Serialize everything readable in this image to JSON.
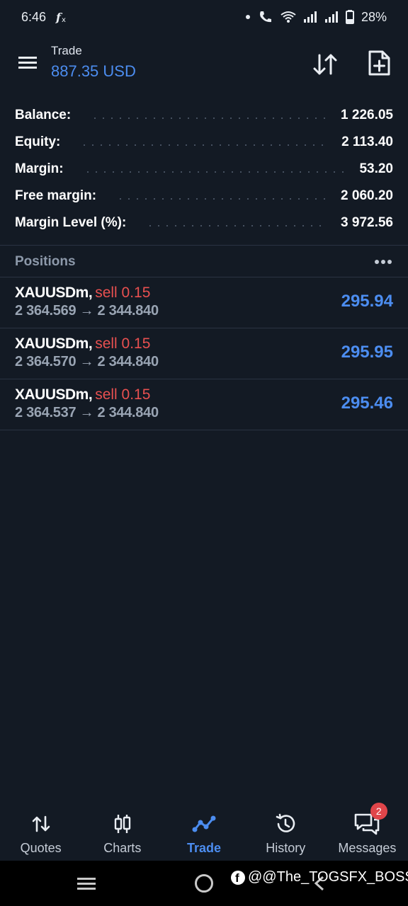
{
  "status_bar": {
    "time": "6:46",
    "battery": "28%"
  },
  "header": {
    "title": "Trade",
    "balance": "887.35 USD"
  },
  "summary": [
    {
      "label": "Balance:",
      "value": "1 226.05"
    },
    {
      "label": "Equity:",
      "value": "2 113.40"
    },
    {
      "label": "Margin:",
      "value": "53.20"
    },
    {
      "label": "Free margin:",
      "value": "2 060.20"
    },
    {
      "label": "Margin Level (%):",
      "value": "3 972.56"
    }
  ],
  "positions": {
    "title": "Positions",
    "items": [
      {
        "symbol": "XAUUSDm,",
        "side": "sell 0.15",
        "prices": "2 364.569 → 2 344.840",
        "profit": "295.94"
      },
      {
        "symbol": "XAUUSDm,",
        "side": "sell 0.15",
        "prices": "2 364.570 → 2 344.840",
        "profit": "295.95"
      },
      {
        "symbol": "XAUUSDm,",
        "side": "sell 0.15",
        "prices": "2 364.537 → 2 344.840",
        "profit": "295.46"
      }
    ]
  },
  "bottom_nav": {
    "items": [
      {
        "label": "Quotes",
        "icon": "quotes-icon"
      },
      {
        "label": "Charts",
        "icon": "candles-icon"
      },
      {
        "label": "Trade",
        "icon": "trade-icon",
        "active": true
      },
      {
        "label": "History",
        "icon": "history-icon"
      },
      {
        "label": "Messages",
        "icon": "messages-icon",
        "badge": "2"
      }
    ]
  },
  "watermark": {
    "text": "@@The_TOGSFX_BOSS"
  },
  "colors": {
    "background": "#131a24",
    "accent": "#4c8df0",
    "sell": "#e85050"
  }
}
